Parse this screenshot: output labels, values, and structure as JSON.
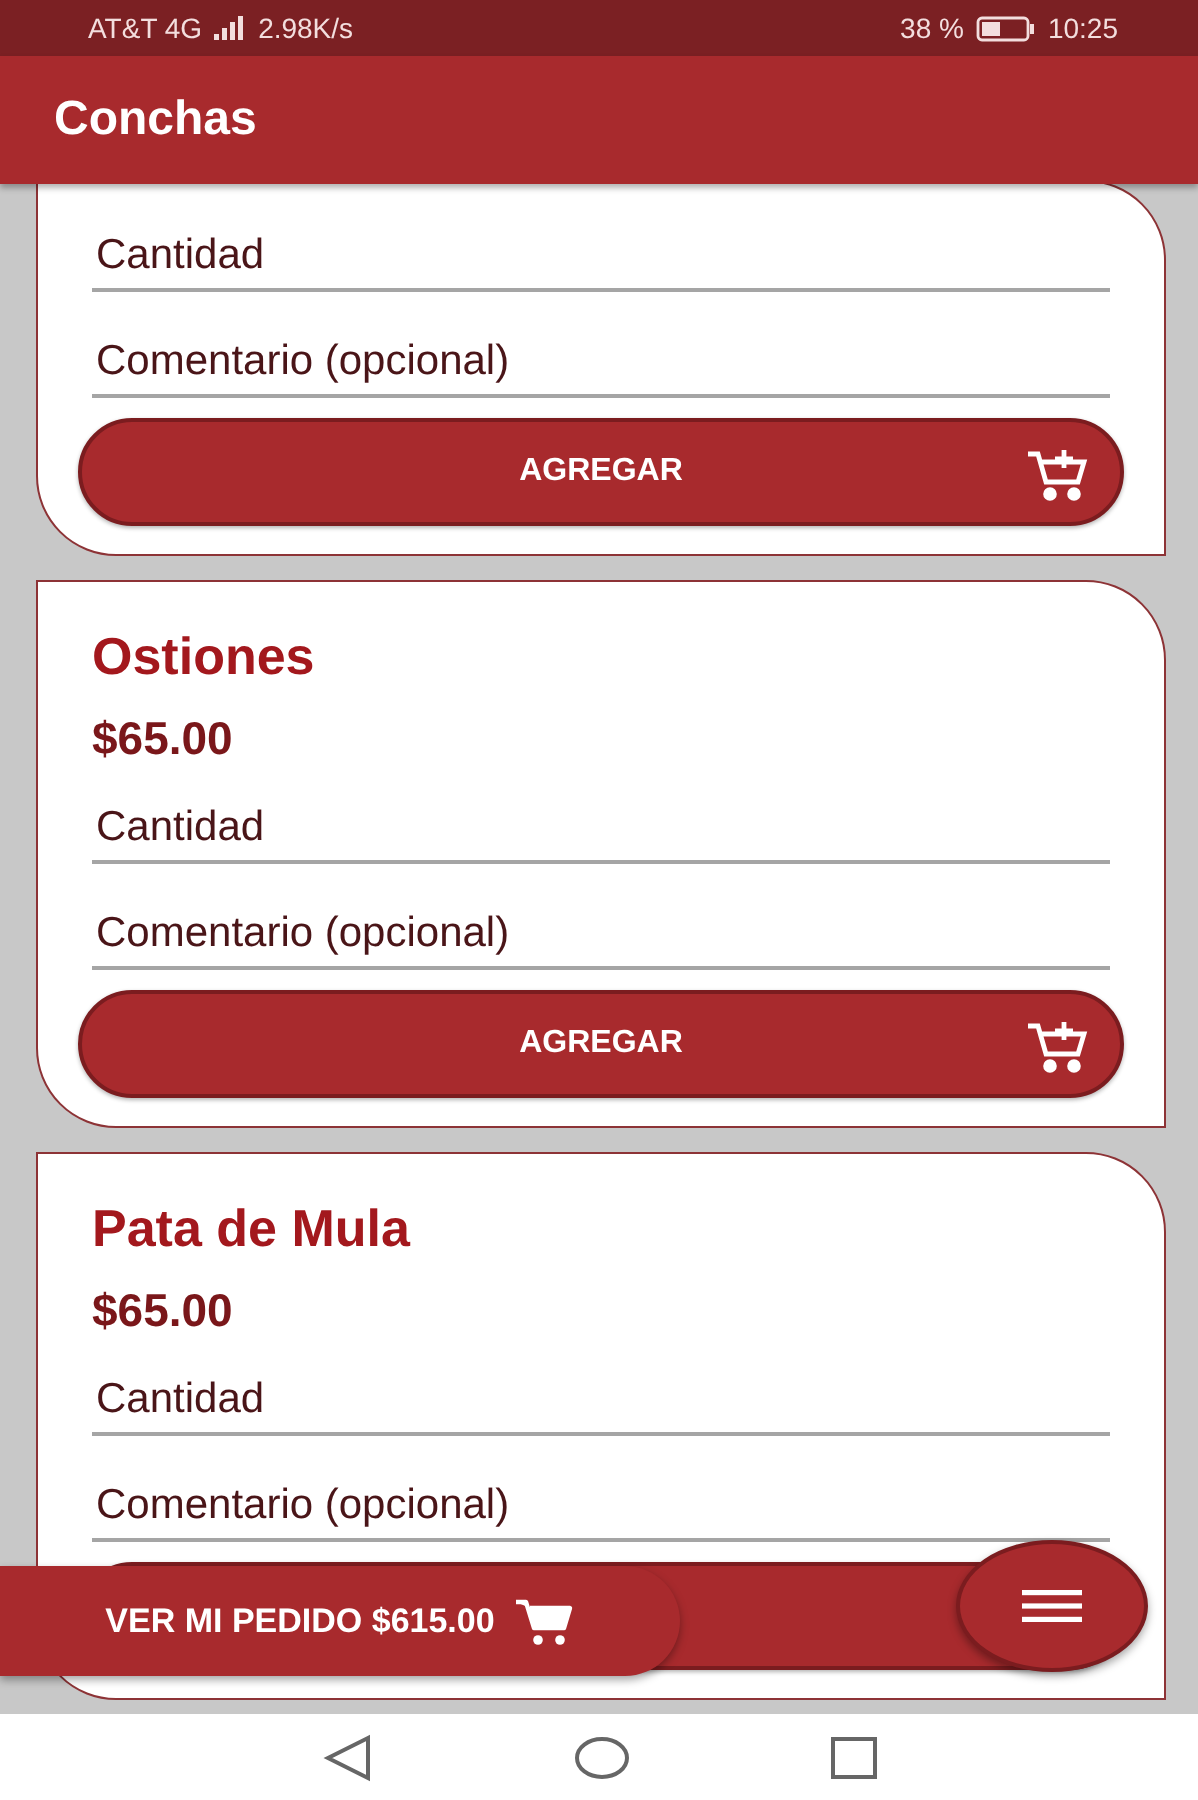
{
  "status_bar": {
    "carrier": "AT&T 4G",
    "speed": "2.98K/s",
    "battery": "38 %",
    "time": "10:25"
  },
  "app_bar": {
    "title": "Conchas"
  },
  "products": [
    {
      "fields": [
        {
          "placeholder": "Cantidad"
        },
        {
          "placeholder": "Comentario (opcional)"
        }
      ],
      "button": "AGREGAR"
    },
    {
      "name": "Ostiones",
      "price": "$65.00",
      "fields": [
        {
          "placeholder": "Cantidad"
        },
        {
          "placeholder": "Comentario (opcional)"
        }
      ],
      "button": "AGREGAR"
    },
    {
      "name": "Pata de Mula",
      "price": "$65.00",
      "fields": [
        {
          "placeholder": "Cantidad"
        },
        {
          "placeholder": "Comentario (opcional)"
        }
      ]
    }
  ],
  "order_button": {
    "label": "VER MI PEDIDO $615.00"
  }
}
